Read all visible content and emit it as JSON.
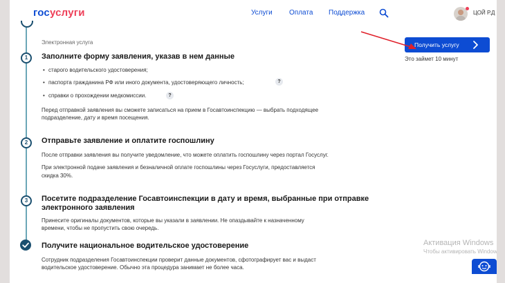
{
  "header": {
    "logo_part1": "гос",
    "logo_part2": "услуги",
    "nav": [
      "Услуги",
      "Оплата",
      "Поддержка"
    ],
    "user_name": "ЦОЙ Р.Д"
  },
  "service_type": "Электронная услуга",
  "cta": {
    "label": "Получить услугу",
    "time_note": "Это займет 10 минут"
  },
  "steps": [
    {
      "number": "1",
      "title": "Заполните форму заявления, указав в нем данные",
      "bullets": [
        "старого водительского удостоверения;",
        "паспорта гражданина РФ или иного документа, удостоверяющего личность;",
        "справки о прохождении медкомиссии."
      ],
      "note_line1": "Перед отправкой заявления вы сможете записаться на прием в Госавтоинспекцию — выбрать подходящее",
      "note_line2": "подразделение, дату и время посещения."
    },
    {
      "number": "2",
      "title": "Отправьте заявление и оплатите госпошлину",
      "para1": "После отправки заявления вы получите уведомление, что можете оплатить госпошлину через портал Госуслуг.",
      "para2_line1": "При электронной подаче заявления и безналичной оплате госпошлины через Госуслуги, предоставляется",
      "para2_line2": "скидка 30%."
    },
    {
      "number": "3",
      "title_line1": "Посетите подразделение Госавтоинспекции в дату и время, выбранные при отправке",
      "title_line2": "электронного заявления",
      "para_line1": "Принесите оригиналы документов, которые вы указали в заявлении. Не опаздывайте к назначенному",
      "para_line2": "времени, чтобы не пропустить свою очередь."
    },
    {
      "title": "Получите национальное водительское удостоверение",
      "para_line1": "Сотрудник подразделения Госавтоинспекции проверит данные документов, сфотографирует вас и выдаст",
      "para_line2": "водительское удостоверение. Обычно эта процедура занимает не более часа."
    }
  ],
  "help_icon_glyph": "?",
  "watermark": {
    "line1": "Активация Windows",
    "line2": "Чтобы активировать Windows, перейдите в раздел \"Параметры\"."
  },
  "colors": {
    "brand_blue": "#0d4cd3",
    "brand_red": "#ee3f58",
    "timeline": "#1a4f6f",
    "arrow": "#e0202a"
  }
}
